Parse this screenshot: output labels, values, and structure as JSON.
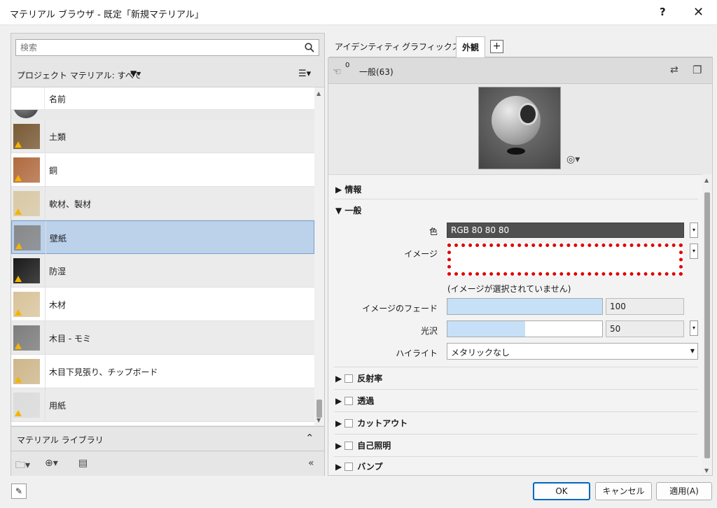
{
  "window": {
    "title": "マテリアル ブラウザ - 既定「新規マテリアル」",
    "help_label": "?",
    "close_label": "✕"
  },
  "left": {
    "search_placeholder": "検索",
    "project_label": "プロジェクト マテリアル: すべて",
    "filter_label": "▼▾",
    "view_label": "☰▾",
    "column_name": "名前",
    "materials": [
      {
        "label": "土類",
        "swatch": "#7a5a35"
      },
      {
        "label": "銅",
        "swatch": "#b06a3f"
      },
      {
        "label": "軟材、製材",
        "swatch": "#d9c9a6"
      },
      {
        "label": "壁紙",
        "swatch": "#888888"
      },
      {
        "label": "防湿",
        "swatch": "#1a1a1a"
      },
      {
        "label": "木材",
        "swatch": "#d8c39a"
      },
      {
        "label": "木目 - モミ",
        "swatch": "#7d7d7d"
      },
      {
        "label": "木目下見張り、チップボード",
        "swatch": "#cdb68a"
      },
      {
        "label": "用紙",
        "swatch": "#dcdcdc"
      }
    ],
    "selected_material": "壁紙",
    "library_label": "マテリアル ライブラリ"
  },
  "right": {
    "tabs": [
      "アイデンティティ",
      "グラフィックス",
      "外観"
    ],
    "active_tab": "外観",
    "add_tab": "+",
    "asset_count": "0",
    "asset_name": "一般(63)",
    "sections": {
      "info": "情報",
      "general": "一般",
      "reflectivity": "反射率",
      "transparency": "透過",
      "cutouts": "カットアウト",
      "self_illum": "自己照明",
      "bump": "バンプ"
    },
    "props": {
      "color_label": "色",
      "color_value": "RGB 80 80 80",
      "image_label": "イメージ",
      "no_image_text": "(イメージが選択されていません)",
      "image_fade_label": "イメージのフェード",
      "image_fade_value": "100",
      "image_fade_fraction": 1.0,
      "glossiness_label": "光沢",
      "glossiness_value": "50",
      "glossiness_fraction": 0.5,
      "highlight_label": "ハイライト",
      "highlight_value": "メタリックなし"
    }
  },
  "buttons": {
    "ok": "OK",
    "cancel": "キャンセル",
    "apply": "適用(A)"
  },
  "colors": {
    "selection": "#bcd1ea",
    "dialog_bg": "#f0f0f0",
    "image_outline": "#e00000"
  }
}
